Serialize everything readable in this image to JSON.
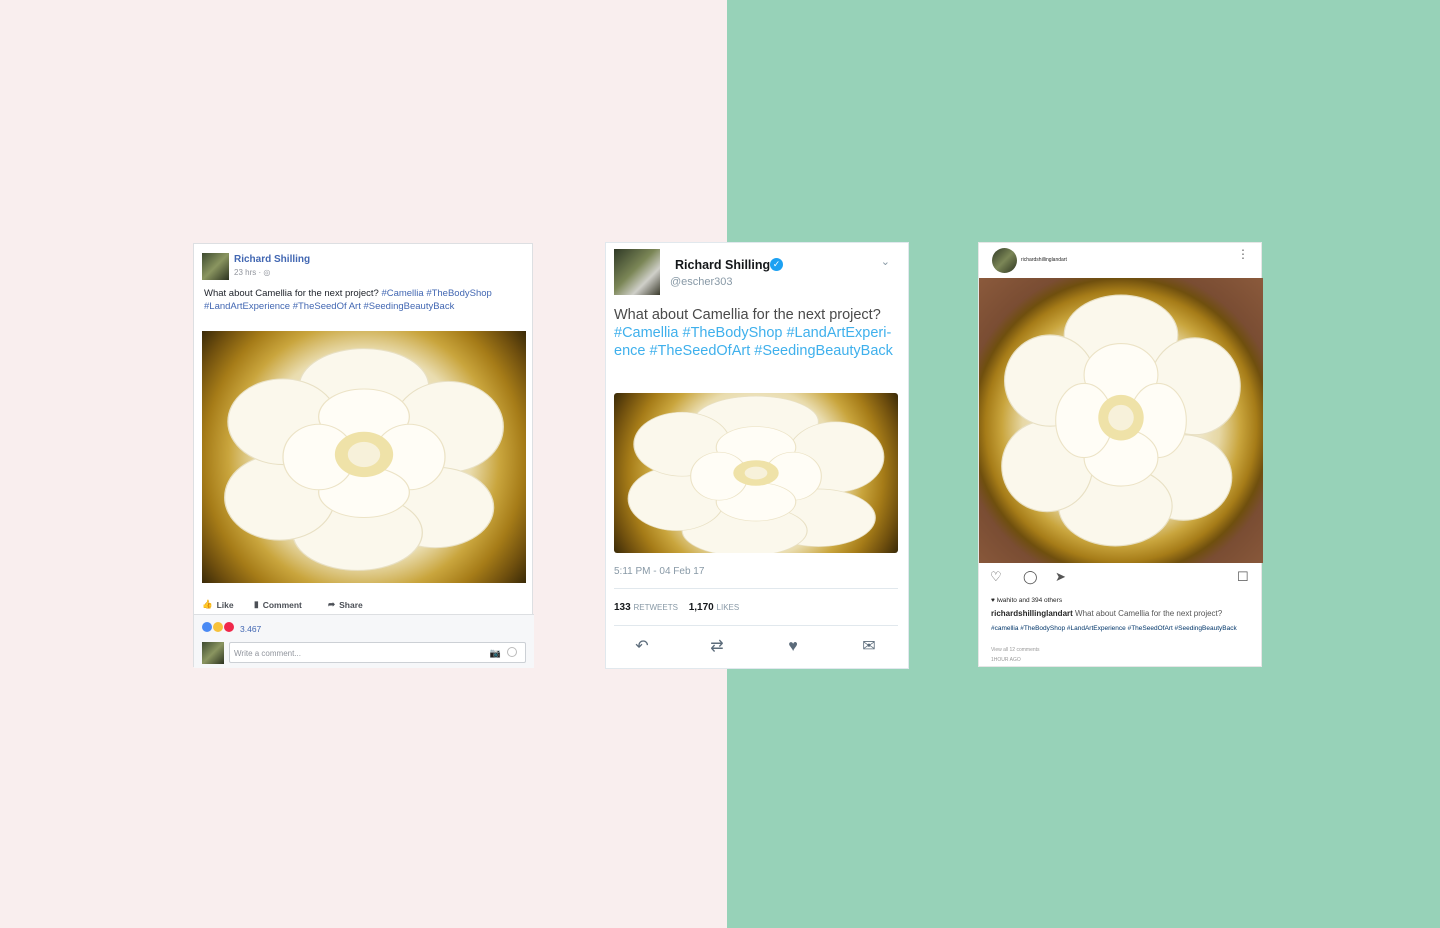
{
  "colors": {
    "left_bg": "#f9eeee",
    "right_bg": "#97d2b8",
    "fb_blue": "#4267b2",
    "tw_blue": "#1da1f2"
  },
  "facebook": {
    "name": "Richard Shilling",
    "meta": "23 hrs ·",
    "text_plain": "What about Camellia for the next project?",
    "text_tags": "#Camellia #TheBodyShop #LandArtExperience #TheSeedOf Art #SeedingBeautyBack",
    "like": "Like",
    "comment": "Comment",
    "share": "Share",
    "reaction_count": "3.467",
    "comment_placeholder": "Write a comment..."
  },
  "twitter": {
    "name": "Richard Shilling",
    "handle": "@escher303",
    "text_plain": "What about Camellia for the next project?",
    "text_tags": "#Camellia #TheBodyShop #LandArtExperi-ence #TheSeedOfArt #SeedingBeautyBack",
    "time": "5:11 PM - 04 Feb 17",
    "retweets_count": "133",
    "retweets_label": "RETWEETS",
    "likes_count": "1,170",
    "likes_label": "LIKES"
  },
  "instagram": {
    "username": "richardshillinglandart",
    "likes": "lwahito and 394 others",
    "caption_user": "richardshillinglandart",
    "caption_text": "What about Camellia for the next project?",
    "tags": "#camellia #TheBodyShop #LandArtExperience #TheSeedOfArt #SeedingBeautyBack",
    "view_all": "View all 12 comments",
    "ago": "1HOUR AGO"
  }
}
